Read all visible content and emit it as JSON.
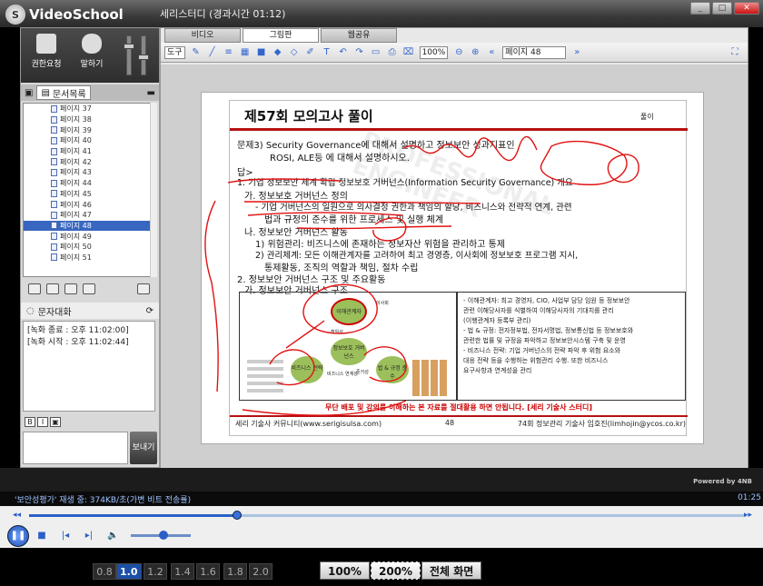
{
  "app": {
    "name": "VideoSchool",
    "window_title": "세리스터디 (경과시간 01:12)",
    "logo_initial": "S"
  },
  "left": {
    "top_buttons": [
      {
        "label": "권한요청"
      },
      {
        "label": "말하기"
      }
    ],
    "doc_tab": "문서목록",
    "pages": [
      "페이지 37",
      "페이지 38",
      "페이지 39",
      "페이지 40",
      "페이지 41",
      "페이지 42",
      "페이지 43",
      "페이지 44",
      "페이지 45",
      "페이지 46",
      "페이지 47",
      "페이지 48",
      "페이지 49",
      "페이지 50",
      "페이지 51"
    ],
    "selected_page": "페이지 48",
    "chat_title": "문자대화",
    "chat_lines": [
      "[녹화 종료 : 오후 11:02:00]",
      "[녹화 시작 : 오후 11:02:44]"
    ],
    "send_label": "보내기",
    "format_buttons": [
      "B",
      "I",
      "▣"
    ]
  },
  "tabs": [
    "비디오",
    "그림판",
    "웹공유"
  ],
  "selected_tab": "그림판",
  "toolbar": {
    "tool_label": "도구",
    "zoom_value": "100%",
    "page_select": "페이지 48"
  },
  "slide": {
    "title": "제57회 모의고사 풀이",
    "badge": "풀이",
    "lines": [
      "문제3) Security Governance에 대해서 설명하고 정보보안 성과지표인",
      "ROSI, ALE등 에 대해서 설명하시오.",
      "답>",
      "1. 기업 정보보안 체계 확립 정보보호 거버넌스(Information Security Governance) 개요",
      "가. 정보보호 거버넌스 정의",
      "- 기업 거버넌스의 일원으로 의사결정 권한과 책임의 할당, 비즈니스와 전략적 연계, 관련",
      "법과 규정의 준수를 위한 프로세스 및 실행 체계",
      "나. 정보보안 거버넌스 활동",
      "1) 위험관리: 비즈니스에 존재하는 정보자산 위험을 관리하고 통제",
      "2) 관리체계: 모든 이해관계자를 고려하여 최고 경영층, 이사회에 정보보호 프로그램 지시,",
      "통제활동, 조직의 역할과 책임, 절차 수립",
      "2. 정보보안 거버넌스 구조 및 주요활동",
      "가. 정보보안 거버넌스 구조"
    ],
    "diagram_nodes": [
      "이해관계자",
      "정보보호 거버넌스",
      "비즈니스 전략",
      "법 & 규정 준수",
      "비즈니스 연계성",
      "준거성",
      "책임성",
      "이사회"
    ],
    "diagram_text": [
      "- 이해관계자: 최고 경영자, CIO, 사업부 담당 임원 등 정보보안",
      "관련 이해당사자를 식별하여 이해당사자의 기대치를 관리",
      "(이행관계자 등록부 관리)",
      "- 법 & 규정: 전자정부법, 전자서명법, 정보통신법 등 정보보호와",
      "관련한 법률 및 규정을 파악하고 정보보안시스템 구축 및 운영",
      "- 비즈니스 전략: 기업 거버넌스의 전략 파악 후 위험 요소와",
      "대응 전략 등을 수행하는 위험관리 수행. 또한 비즈니스",
      "요구사항과 연계성을 관리"
    ],
    "footer_warning": "무단 배포 및 강의를 이해하는 본 자료를 절대활용 하면 안됩니다. [세리 기술사 스터디]",
    "footer_left": "세리 기술사 커뮤니티(www.serigisulsa.com)",
    "footer_page": "48",
    "footer_right": "74회 정보관리 기술사 임호진(limhojin@ycos.co.kr)",
    "watermark": "PROFESSIONAL ENGINEER"
  },
  "powered": "Powered by 4NB",
  "player": {
    "status": "'보안성평가' 재생 중: 374KB/초(가변 비트 전송률)",
    "time": "01:25",
    "progress": 0.29,
    "volume": 0.55
  },
  "speeds": [
    "0.8",
    "1.0",
    "1.2",
    "1.4",
    "1.6",
    "1.8",
    "2.0"
  ],
  "selected_speed": "1.0",
  "zoom_buttons": [
    "100%",
    "200%",
    "전체 화면"
  ],
  "selected_zoom": "200%",
  "colors": {
    "accent": "#3866c0",
    "ink": "#e21111",
    "brand_red": "#b61111"
  }
}
